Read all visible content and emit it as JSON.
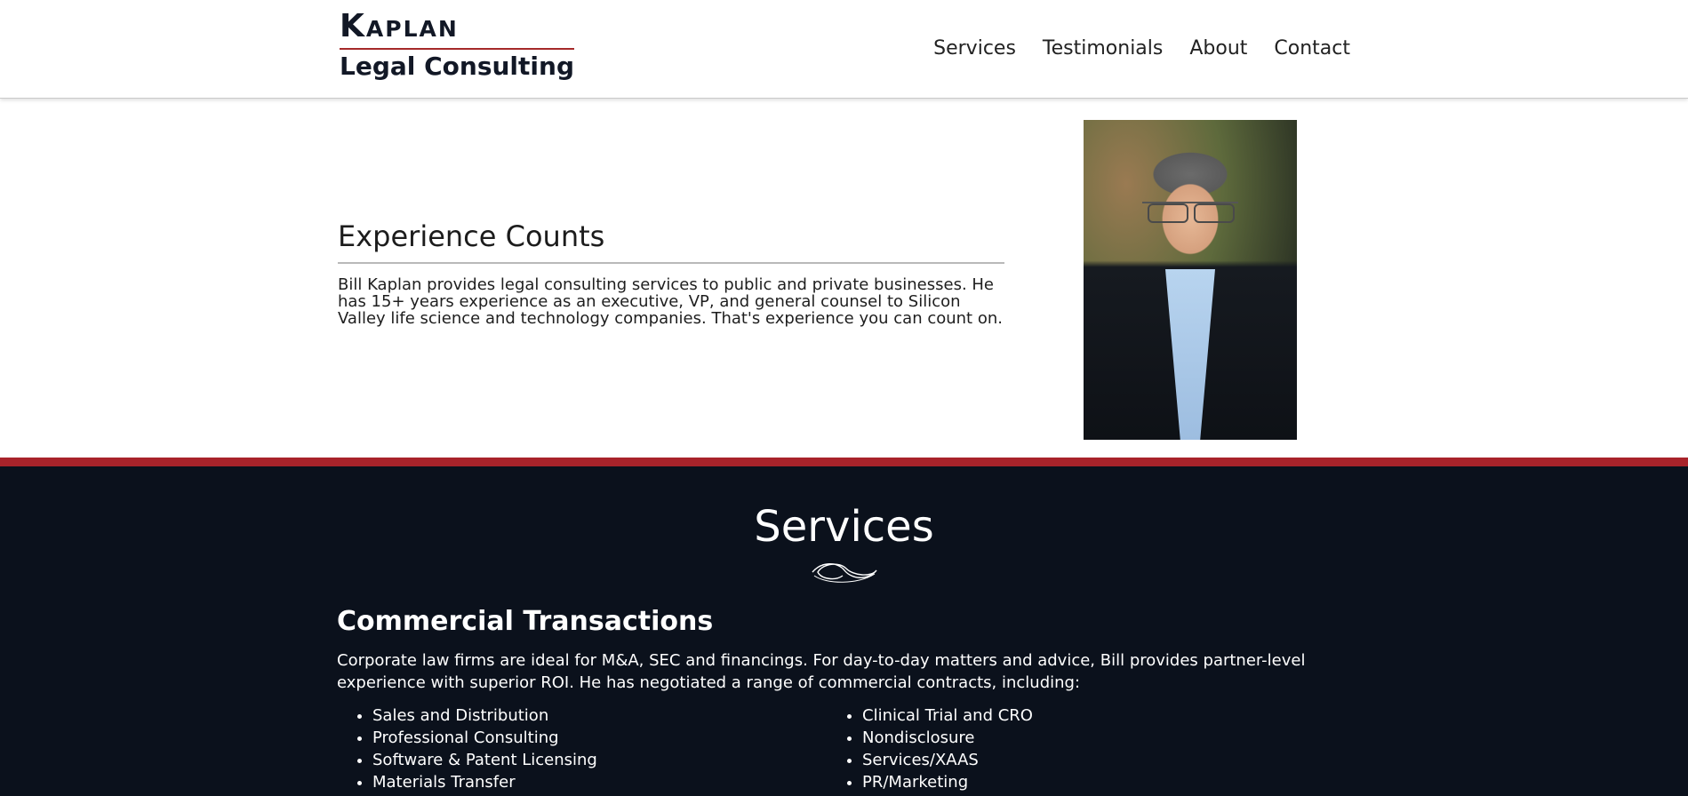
{
  "header": {
    "logo_top": "Kaplan",
    "logo_bottom": "Legal Consulting",
    "nav": [
      "Services",
      "Testimonials",
      "About",
      "Contact"
    ]
  },
  "hero": {
    "title": "Experience Counts",
    "body": "Bill Kaplan provides legal consulting services to public and private businesses. He has 15+ years experience as an executive, VP, and general counsel to Silicon Valley life science and technology companies. That's experience you can count on."
  },
  "services": {
    "title": "Services",
    "commercial": {
      "title": "Commercial Transactions",
      "body": "Corporate law firms are ideal for M&A, SEC and financings.  For day-to-day matters and advice, Bill provides partner-level experience with superior ROI.  He has negotiated a range of commercial contracts, including:",
      "left_items": [
        "Sales and Distribution",
        "Professional Consulting",
        "Software & Patent Licensing",
        "Materials Transfer"
      ],
      "right_items": [
        "Clinical Trial and CRO",
        "Nondisclosure",
        "Services/XAAS",
        "PR/Marketing"
      ]
    }
  },
  "colors": {
    "accent_red": "#a8232a",
    "dark_navy": "#0b111c"
  }
}
